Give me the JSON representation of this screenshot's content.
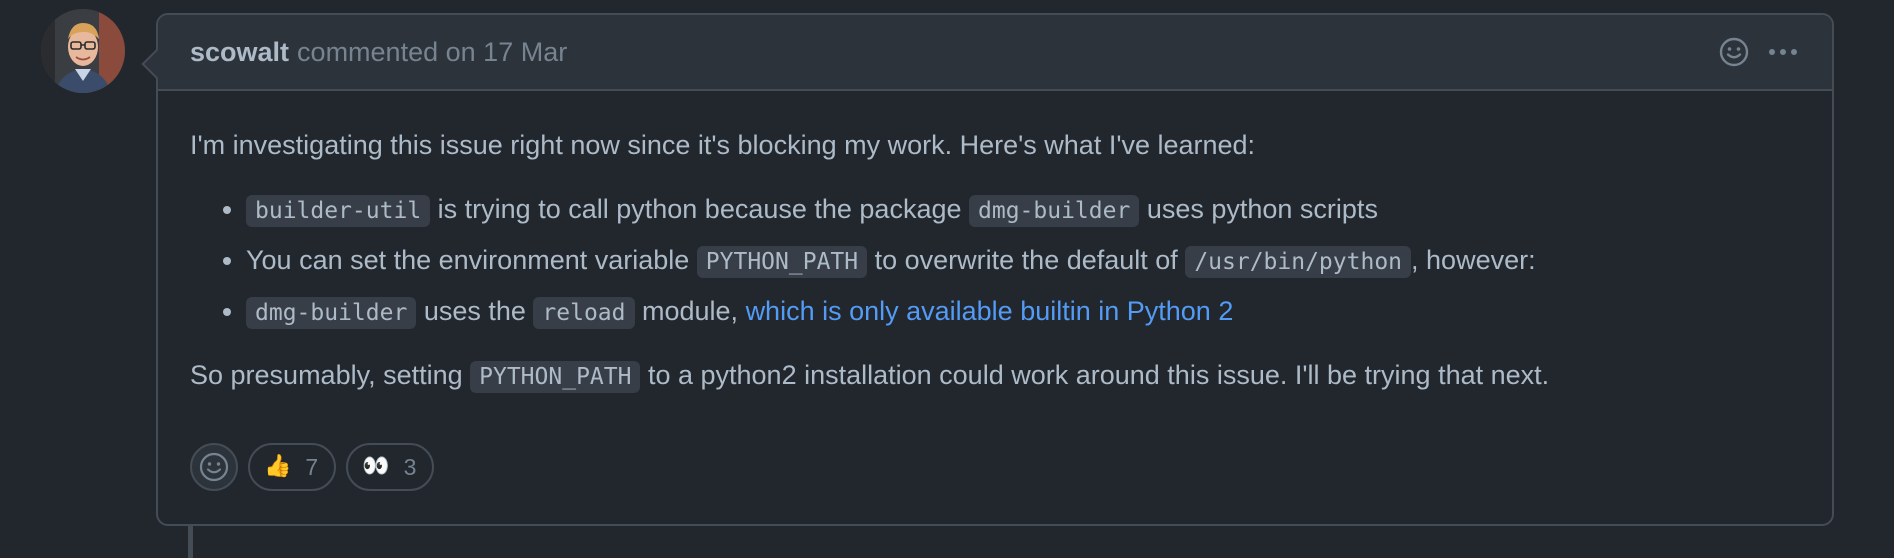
{
  "comment": {
    "author": "scowalt",
    "action": "commented on",
    "date": "17 Mar",
    "intro": "I'm investigating this issue right now since it's blocking my work. Here's what I've learned:",
    "bullets": [
      {
        "code1": "builder-util",
        "text1": " is trying to call python because the package ",
        "code2": "dmg-builder",
        "text2": " uses python scripts"
      },
      {
        "text0": "You can set the environment variable ",
        "code1": "PYTHON_PATH",
        "text1": " to overwrite the default of ",
        "code2": "/usr/bin/python",
        "text2": ", however:"
      },
      {
        "code1": "dmg-builder",
        "text1": " uses the ",
        "code2": "reload",
        "text2": " module, ",
        "link": "which is only available builtin in Python 2"
      }
    ],
    "closing": {
      "text0": "So presumably, setting ",
      "code1": "PYTHON_PATH",
      "text1": " to a python2 installation could work around this issue. I'll be trying that next."
    },
    "reactions": [
      {
        "emoji": "👍",
        "icon": "thumbs-up-emoji",
        "count": "7"
      },
      {
        "emoji": "👀",
        "icon": "eyes-emoji",
        "count": "3"
      }
    ]
  },
  "icons": {
    "header_reaction": "smiley-icon",
    "header_menu": "kebab-horizontal-icon",
    "add_reaction": "smiley-icon"
  },
  "colors": {
    "background": "#22272e",
    "header_background": "#2d333b",
    "border": "#444c56",
    "text": "#adbac7",
    "muted": "#768390",
    "link": "#539bf5"
  }
}
